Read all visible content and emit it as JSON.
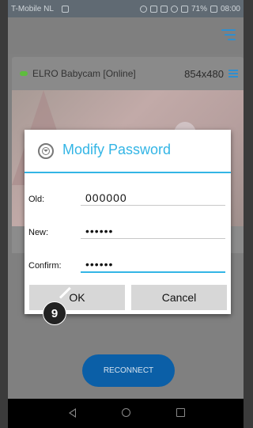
{
  "status_bar": {
    "carrier": "T-Mobile NL",
    "battery": "71%",
    "time": "08:00"
  },
  "camera": {
    "name": "ELRO Babycam [Online]",
    "resolution": "854x480",
    "status_color": "#5ebd3e"
  },
  "dialog": {
    "title": "Modify Password",
    "old_label": "Old:",
    "old_value": "000000",
    "new_label": "New:",
    "new_value": "000000",
    "confirm_label": "Confirm:",
    "confirm_value": "000000",
    "ok_label": "OK",
    "cancel_label": "Cancel",
    "accent_color": "#33b5e5"
  },
  "reconnect_label": "RECONNECT",
  "step_badge": "9",
  "icons": {
    "menu": "hamburger-menu-icon",
    "tune": "settings-sliders-icon",
    "dialog": "password-lock-icon",
    "nav_back": "back-triangle-icon",
    "nav_home": "home-circle-icon",
    "nav_recent": "recent-apps-square-icon"
  }
}
